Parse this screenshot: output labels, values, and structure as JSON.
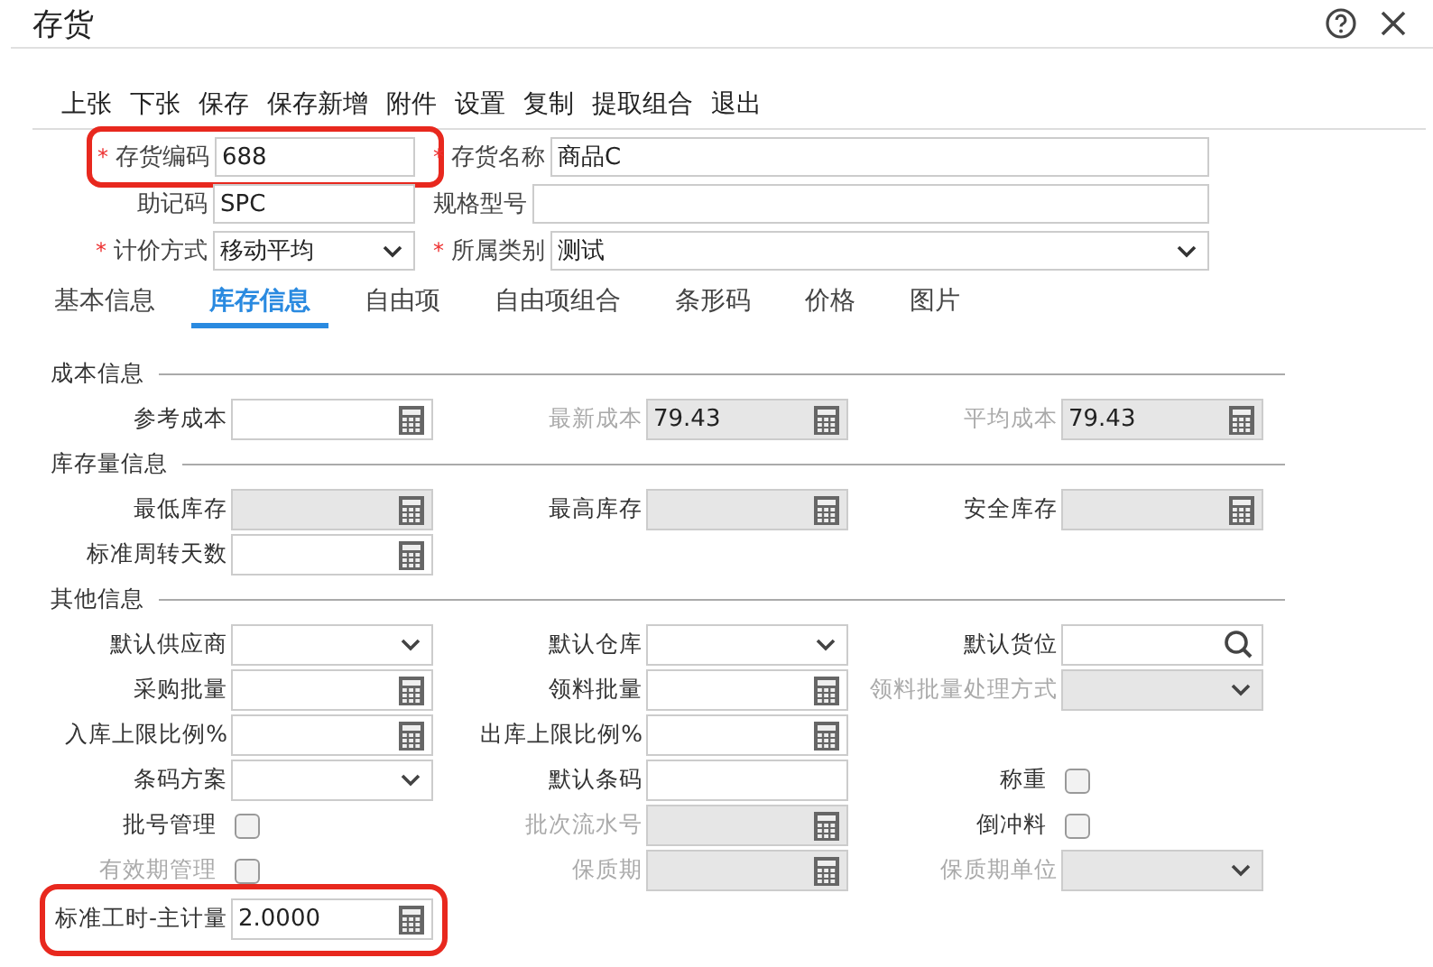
{
  "window": {
    "title": "存货"
  },
  "toolbar": [
    "上张",
    "下张",
    "保存",
    "保存新增",
    "附件",
    "设置",
    "复制",
    "提取组合",
    "退出"
  ],
  "header_rows": [
    [
      {
        "label": "存货编码",
        "required_mark": "*",
        "kind": "text",
        "value": "688",
        "highlighted": true
      },
      {
        "label": "存货名称",
        "required_mark": "*",
        "kind": "text",
        "value": "商品C",
        "highlighted": false
      }
    ],
    [
      {
        "label": "助记码",
        "kind": "text",
        "value": "SPC",
        "highlighted": false
      },
      {
        "label": "规格型号",
        "kind": "text",
        "highlighted": false
      }
    ],
    [
      {
        "label": "计价方式",
        "required_mark": "*",
        "kind": "select",
        "value": "移动平均",
        "highlighted": false
      },
      {
        "label": "所属类别",
        "required_mark": "*",
        "kind": "select",
        "value": "测试",
        "highlighted": false
      }
    ]
  ],
  "tabs": [
    {
      "label": "基本信息",
      "selected": false
    },
    {
      "label": "库存信息",
      "selected": true
    },
    {
      "label": "自由项",
      "selected": false
    },
    {
      "label": "自由项组合",
      "selected": false
    },
    {
      "label": "条形码",
      "selected": false
    },
    {
      "label": "价格",
      "selected": false
    },
    {
      "label": "图片",
      "selected": false
    }
  ],
  "sections": [
    {
      "title": "成本信息",
      "rows": [
        [
          {
            "kind": "number",
            "label": "参考成本",
            "label_disabled": false,
            "disabled": false,
            "highlighted": false
          },
          {
            "kind": "number",
            "label": "最新成本",
            "label_disabled": true,
            "disabled": true,
            "value": "79.43",
            "highlighted": false
          },
          {
            "kind": "number",
            "label": "平均成本",
            "label_disabled": true,
            "disabled": true,
            "value": "79.43",
            "highlighted": false
          }
        ]
      ]
    },
    {
      "title": "库存量信息",
      "rows": [
        [
          {
            "kind": "number",
            "label": "最低库存",
            "label_disabled": false,
            "disabled": true,
            "highlighted": false
          },
          {
            "kind": "number",
            "label": "最高库存",
            "label_disabled": false,
            "disabled": true,
            "highlighted": false
          },
          {
            "kind": "number",
            "label": "安全库存",
            "label_disabled": false,
            "disabled": true,
            "highlighted": false
          }
        ],
        [
          {
            "kind": "number",
            "label": "标准周转天数",
            "label_disabled": false,
            "disabled": false,
            "highlighted": false
          },
          {
            "kind": "empty"
          },
          {
            "kind": "empty"
          }
        ]
      ]
    },
    {
      "title": "其他信息",
      "rows": [
        [
          {
            "kind": "select",
            "label": "默认供应商",
            "label_disabled": false,
            "disabled": false,
            "highlighted": false
          },
          {
            "kind": "select",
            "label": "默认仓库",
            "label_disabled": false,
            "disabled": false,
            "highlighted": false
          },
          {
            "kind": "search",
            "label": "默认货位",
            "label_disabled": false,
            "disabled": false,
            "highlighted": false
          }
        ],
        [
          {
            "kind": "number",
            "label": "采购批量",
            "label_disabled": false,
            "disabled": false,
            "highlighted": false
          },
          {
            "kind": "number",
            "label": "领料批量",
            "label_disabled": false,
            "disabled": false,
            "highlighted": false
          },
          {
            "kind": "select",
            "label": "领料批量处理方式",
            "label_disabled": true,
            "disabled": true,
            "highlighted": false
          }
        ],
        [
          {
            "kind": "number",
            "label": "入库上限比例%",
            "label_disabled": false,
            "disabled": false,
            "highlighted": false
          },
          {
            "kind": "number",
            "label": "出库上限比例%",
            "label_disabled": false,
            "disabled": false,
            "highlighted": false
          },
          {
            "kind": "empty"
          }
        ],
        [
          {
            "kind": "select",
            "label": "条码方案",
            "label_disabled": false,
            "disabled": false,
            "highlighted": false
          },
          {
            "kind": "text",
            "label": "默认条码",
            "label_disabled": false,
            "disabled": false,
            "highlighted": false
          },
          {
            "kind": "checkbox",
            "label": "称重",
            "label_disabled": false,
            "checked": false,
            "highlighted": false
          }
        ],
        [
          {
            "kind": "checkbox",
            "label": "批号管理",
            "label_disabled": false,
            "checked": false,
            "highlighted": false
          },
          {
            "kind": "number",
            "label": "批次流水号",
            "label_disabled": true,
            "disabled": true,
            "highlighted": false
          },
          {
            "kind": "checkbox",
            "label": "倒冲料",
            "label_disabled": false,
            "checked": false,
            "highlighted": false
          }
        ],
        [
          {
            "kind": "checkbox",
            "label": "有效期管理",
            "label_disabled": true,
            "checked": false,
            "highlighted": false
          },
          {
            "kind": "number",
            "label": "保质期",
            "label_disabled": true,
            "disabled": true,
            "highlighted": false
          },
          {
            "kind": "select",
            "label": "保质期单位",
            "label_disabled": true,
            "disabled": true,
            "highlighted": false
          }
        ],
        [
          {
            "kind": "number",
            "label": "标准工时-主计量",
            "label_disabled": false,
            "disabled": false,
            "value": "2.0000",
            "highlighted": true
          },
          {
            "kind": "empty"
          },
          {
            "kind": "empty"
          }
        ]
      ]
    }
  ]
}
